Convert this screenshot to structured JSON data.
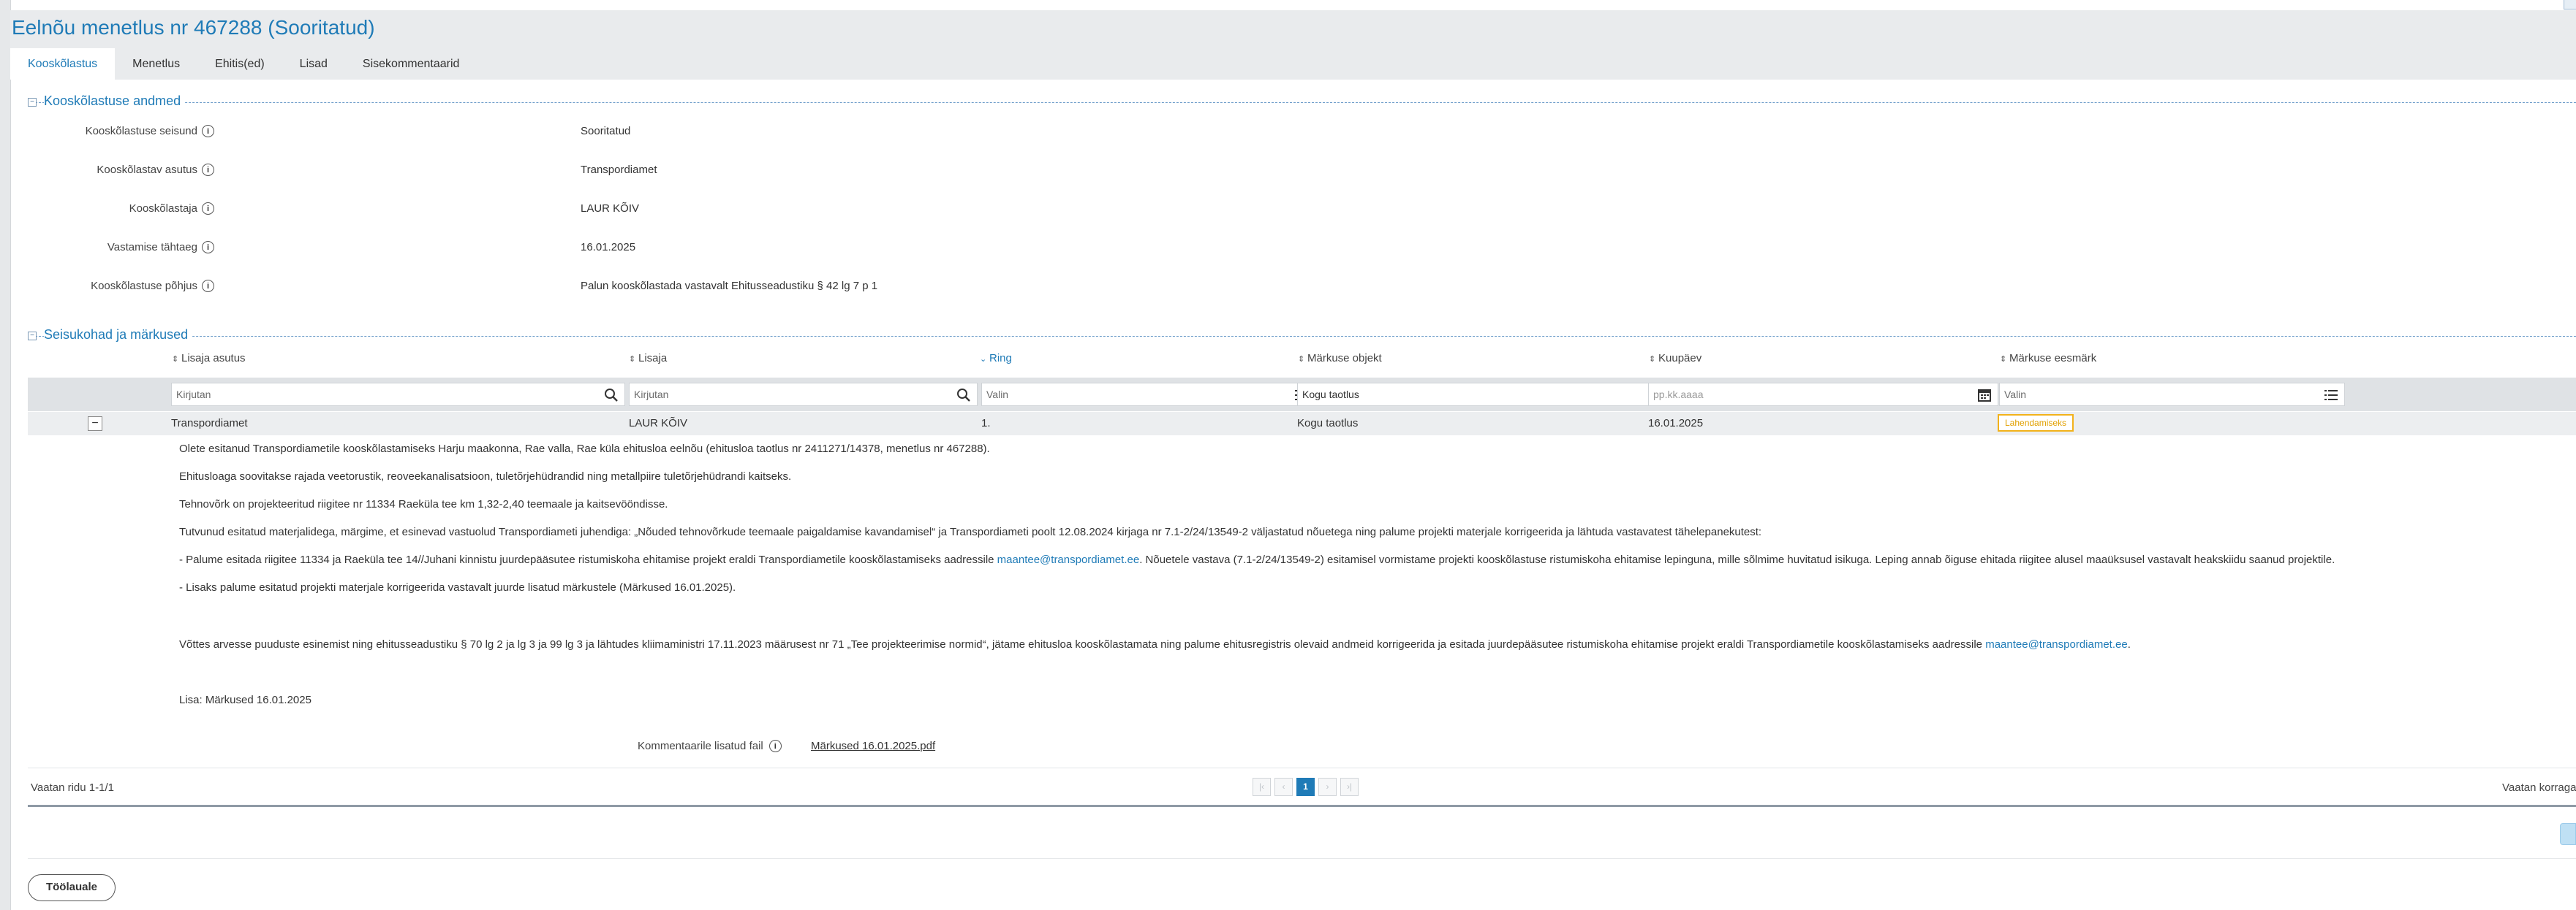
{
  "page": {
    "title": "Eelnõu menetlus nr 467288 (Sooritatud)"
  },
  "tabs": [
    {
      "label": "Kooskõlastus",
      "active": true
    },
    {
      "label": "Menetlus"
    },
    {
      "label": "Ehitis(ed)"
    },
    {
      "label": "Lisad"
    },
    {
      "label": "Sisekommentaarid"
    }
  ],
  "section1": {
    "title": "Kooskõlastuse andmed",
    "fields": [
      {
        "label": "Kooskõlastuse seisund",
        "value": "Sooritatud"
      },
      {
        "label": "Kooskõlastav asutus",
        "value": "Transpordiamet"
      },
      {
        "label": "Kooskõlastaja",
        "value": "LAUR KÕIV"
      },
      {
        "label": "Vastamise tähtaeg",
        "value": "16.01.2025"
      },
      {
        "label": "Kooskõlastuse põhjus",
        "value": "Palun kooskõlastada vastavalt Ehitusseadustiku § 42 lg 7 p 1"
      }
    ]
  },
  "section2": {
    "title": "Seisukohad ja märkused",
    "columns": [
      "Lisaja asutus",
      "Lisaja",
      "Ring",
      "Märkuse objekt",
      "Kuupäev",
      "Märkuse eesmärk"
    ],
    "filters": [
      "Kirjutan",
      "Kirjutan",
      "Valin",
      "Kogu taotlus",
      "pp.kk.aaaa",
      "Valin"
    ],
    "row": {
      "toggle": "−",
      "agency": "Transpordiamet",
      "author": "LAUR KÕIV",
      "round": "1.",
      "object": "Kogu taotlus",
      "date": "16.01.2025",
      "purpose": "Lahendamiseks"
    },
    "comment": {
      "p1": "Olete esitanud Transpordiametile kooskõlastamiseks Harju maakonna, Rae valla, Rae küla ehitusloa eelnõu (ehitusloa taotlus nr 2411271/14378, menetlus nr 467288).",
      "p2": "Ehitusloaga soovitakse rajada veetorustik, reoveekanalisatsioon, tuletõrjehüdrandid ning metallpiire tuletõrjehüdrandi kaitseks.",
      "p3": "Tehnovõrk on projekteeritud riigitee nr 11334 Raeküla tee km 1,32-2,40 teemaale ja kaitsevööndisse.",
      "p4": "Tutvunud esitatud materjalidega, märgime, et esinevad vastuolud Transpordiameti juhendiga: „Nõuded tehnovõrkude teemaale paigaldamise kavandamisel“ ja Transpordiameti poolt 12.08.2024 kirjaga nr 7.1-2/24/13549-2 väljastatud nõuetega ning palume projekti materjale korrigeerida ja lähtuda vastavatest tähelepanekutest:",
      "p5a": "-  Palume esitada riigitee 11334 ja Raeküla tee 14//Juhani kinnistu juurdepääsutee ristumiskoha ehitamise projekt eraldi Transpordiametile kooskõlastamiseks aadressile ",
      "p5link": "maantee@transpordiamet.ee",
      "p5b": ". Nõuetele vastava (7.1-2/24/13549-2) esitamisel vormistame projekti kooskõlastuse ristumiskoha ehitamise lepinguna, mille sõlmime huvitatud isikuga. Leping annab õiguse ehitada riigitee alusel maaüksusel vastavalt heakskiidu saanud projektile.",
      "p6": "-  Lisaks palume esitatud projekti materjale korrigeerida vastavalt juurde lisatud märkustele (Märkused 16.01.2025).",
      "p7a": "Võttes arvesse puuduste esinemist ning ehitusseadustiku § 70 lg 2 ja lg 3 ja 99 lg 3 ja lähtudes kliimaministri 17.11.2023 määrusest nr 71 „Tee projekteerimise normid“, jätame ehitusloa kooskõlastamata ning palume ehitusregistris olevaid andmeid korrigeerida ja esitada juurdepääsutee ristumiskoha ehitamise projekt eraldi Transpordiametile kooskõlastamiseks aadressile ",
      "p7link": "maantee@transpordiamet.ee",
      "p7b": ".",
      "p8": "Lisa: Märkused 16.01.2025"
    },
    "attachment": {
      "label": "Kommentaarile lisatud fail",
      "file": "Märkused 16.01.2025.pdf"
    },
    "footer": {
      "rows_info": "Vaatan ridu 1-1/1",
      "right_info": "Vaatan korraga",
      "pager": [
        "|‹",
        "‹",
        "1",
        "›",
        "›|"
      ],
      "current_page": 1
    }
  },
  "actions": {
    "back": "Töölauale"
  },
  "colors": {
    "accent": "#1f7bb7",
    "badge": "#f2b21b",
    "header_bg": "#e9ebed"
  }
}
